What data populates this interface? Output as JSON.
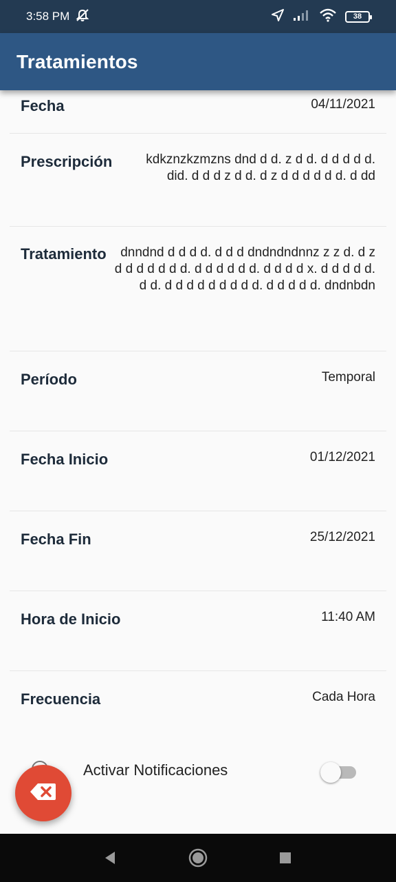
{
  "status_bar": {
    "time": "3:58 PM",
    "battery": "38",
    "icons": [
      "mute-icon",
      "location-icon",
      "signal-icon",
      "wifi-icon",
      "battery-icon"
    ]
  },
  "app_bar": {
    "title": "Tratamientos"
  },
  "details": {
    "fecha": {
      "label": "Fecha",
      "value": "04/11/2021"
    },
    "prescripcion": {
      "label": "Prescripción",
      "value": "kdkznzkzmzns dnd d d. z d d. d d d d d. did. d d d z d d. d z d d d d d d. d dd"
    },
    "tratamiento": {
      "label": "Tratamiento",
      "value": "dnndnd d d d d. d d d dndndndnnz z z d. d z d d d d d d d. d d d d d d. d d d d x. d d d d d. d d. d d d d d d d d d. d d d d d. dndnbdn"
    },
    "periodo": {
      "label": "Período",
      "value": "Temporal"
    },
    "fecha_inicio": {
      "label": "Fecha Inicio",
      "value": "01/12/2021"
    },
    "fecha_fin": {
      "label": "Fecha Fin",
      "value": "25/12/2021"
    },
    "hora_inicio": {
      "label": "Hora de Inicio",
      "value": "11:40 AM"
    },
    "frecuencia": {
      "label": "Frecuencia",
      "value": "Cada Hora"
    }
  },
  "notifications": {
    "label": "Activar Notificaciones",
    "enabled": false
  },
  "fab": {
    "icon": "backspace-icon"
  },
  "colors": {
    "status_bar": "#233a52",
    "app_bar": "#2e5784",
    "fab": "#e04a35",
    "background": "#fafafa"
  }
}
